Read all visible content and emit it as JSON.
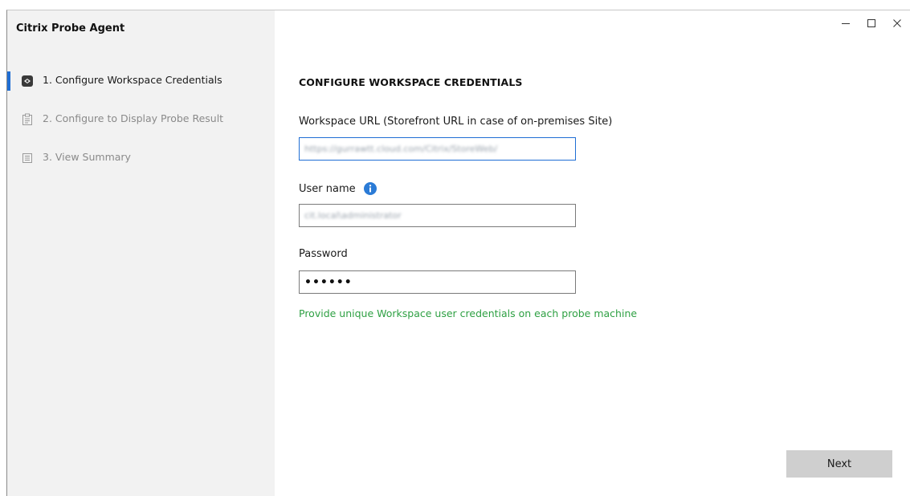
{
  "app": {
    "title": "Citrix Probe Agent"
  },
  "window_controls": {
    "minimize_icon": "minimize-icon",
    "maximize_icon": "maximize-icon",
    "close_icon": "close-icon"
  },
  "steps": [
    {
      "label": "1. Configure Workspace Credentials",
      "icon": "credentials-icon",
      "active": true
    },
    {
      "label": "2. Configure to Display Probe Result",
      "icon": "clipboard-icon",
      "active": false
    },
    {
      "label": "3. View Summary",
      "icon": "summary-icon",
      "active": false
    }
  ],
  "form": {
    "heading": "CONFIGURE WORKSPACE CREDENTIALS",
    "url": {
      "label": "Workspace URL (Storefront URL in case of on-premises Site)",
      "value": "https://gurrawtt.cloud.com/Citrix/StoreWeb/"
    },
    "username": {
      "label": "User name",
      "value": "cit.local\\administrator"
    },
    "password": {
      "label": "Password",
      "value": "••••••"
    },
    "hint": "Provide unique Workspace user credentials on each probe machine",
    "next_label": "Next"
  },
  "colors": {
    "accent": "#1f6ed4",
    "hint_green": "#2ea043",
    "sidebar_bg": "#f2f2f2",
    "button_bg": "#cfcfcf"
  }
}
